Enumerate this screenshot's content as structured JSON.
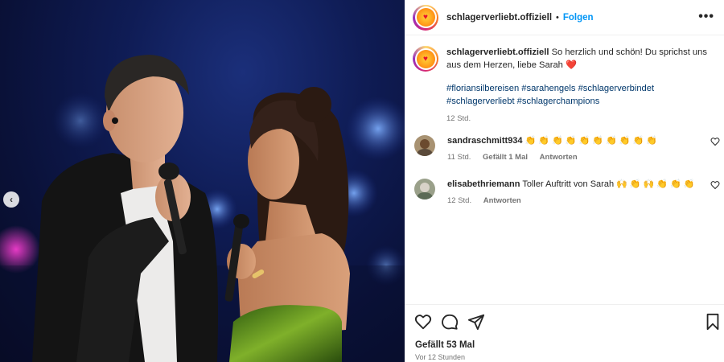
{
  "post": {
    "username": "schlagerverliebt.offiziell",
    "separator": "•",
    "follow_label": "Folgen",
    "more_label": "•••",
    "avatar_heart": "♥",
    "caption": {
      "username": "schlagerverliebt.offiziell",
      "text": "So herzlich und schön! Du sprichst uns aus dem Herzen, liebe Sarah",
      "emoji": "❤️",
      "hashtags_line1": "#floriansilbereisen #sarahengels #schlagerverbindet",
      "hashtags_line2": "#schlagerverliebt #schlagerchampions",
      "time": "12 Std."
    },
    "comments": [
      {
        "username": "sandraschmitt934",
        "text": "👏 👏 👏 👏 👏 👏 👏 👏 👏 👏",
        "time": "11 Std.",
        "likes": "Gefällt 1 Mal",
        "reply": "Antworten"
      },
      {
        "username": "elisabethriemann",
        "text": "Toller Auftritt von Sarah 🙌 👏 🙌 👏 👏 👏",
        "time": "12 Std.",
        "reply": "Antworten"
      }
    ],
    "likes_label": "Gefällt 53 Mal",
    "posted_ago": "Vor 12 Stunden"
  },
  "media": {
    "prev_arrow": "‹",
    "scene_icons": [
      "microphone-icon",
      "stage-lights"
    ]
  },
  "icons": {
    "like": "heart-icon",
    "comment": "comment-icon",
    "share": "share-icon",
    "save": "bookmark-icon",
    "more": "more-icon"
  },
  "colors": {
    "accent": "#0095f6",
    "hashtag": "#00376b",
    "muted": "#737373",
    "text": "#262626",
    "heart": "#ed4956"
  }
}
